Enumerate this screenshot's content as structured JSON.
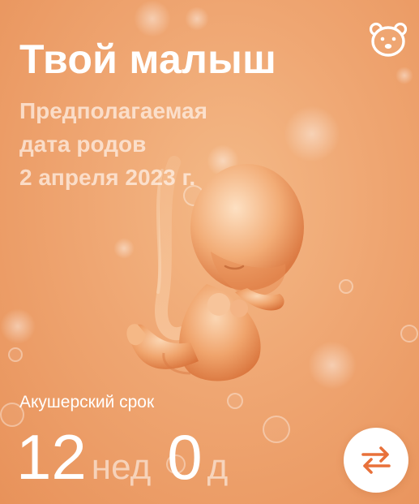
{
  "baby": {
    "title": "Твой малыш",
    "due_lines": [
      "Предполагаемая",
      "дата родов",
      "2 апреля 2023 г."
    ]
  },
  "term": {
    "label": "Акушерский срок",
    "weeks": "12",
    "weeks_unit": "нед",
    "days": "0",
    "days_unit": "д"
  },
  "icons": {
    "profile": "bear-face-icon",
    "toggle": "swap-arrows-icon"
  },
  "colors": {
    "background": "#efa672",
    "accent": "#e8713a",
    "text": "#ffffff"
  }
}
